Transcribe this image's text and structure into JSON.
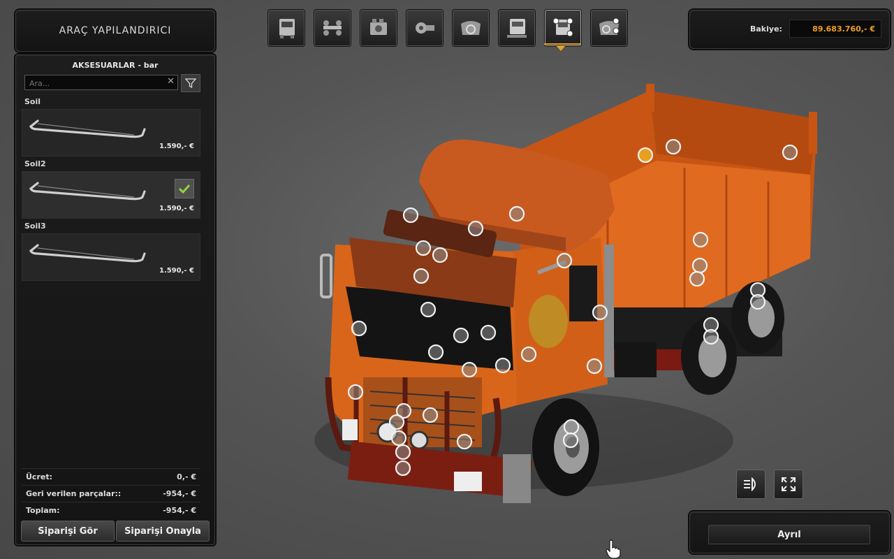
{
  "header": {
    "title": "ARAÇ YAPILANDIRICI"
  },
  "category": {
    "title": "AKSESUARLAR - bar"
  },
  "search": {
    "placeholder": "Ara..."
  },
  "items": [
    {
      "name": "Soil",
      "price": "1.590,- €",
      "selected": false
    },
    {
      "name": "Soil2",
      "price": "1.590,- €",
      "selected": true
    },
    {
      "name": "Soil3",
      "price": "1.590,- €",
      "selected": false
    }
  ],
  "summary": {
    "fee_label": "Ücret:",
    "fee_value": "0,- €",
    "returned_label": "Geri verilen parçalar::",
    "returned_value": "-954,- €",
    "total_label": "Toplam:",
    "total_value": "-954,- €"
  },
  "buttons": {
    "view_order": "Siparişi Gör",
    "confirm_order": "Siparişi Onayla",
    "exit": "Ayrıl"
  },
  "balance": {
    "label": "Bakiye:",
    "value": "89.683.760,- €"
  },
  "tabs": [
    {
      "icon": "cab-icon"
    },
    {
      "icon": "chassis-icon"
    },
    {
      "icon": "engine-icon"
    },
    {
      "icon": "transmission-icon"
    },
    {
      "icon": "interior-icon"
    },
    {
      "icon": "paint-icon"
    },
    {
      "icon": "accessories-icon",
      "active": true
    },
    {
      "icon": "interior-accessories-icon"
    }
  ],
  "colors": {
    "accent": "#e8a020",
    "truck": "#d8621a"
  }
}
